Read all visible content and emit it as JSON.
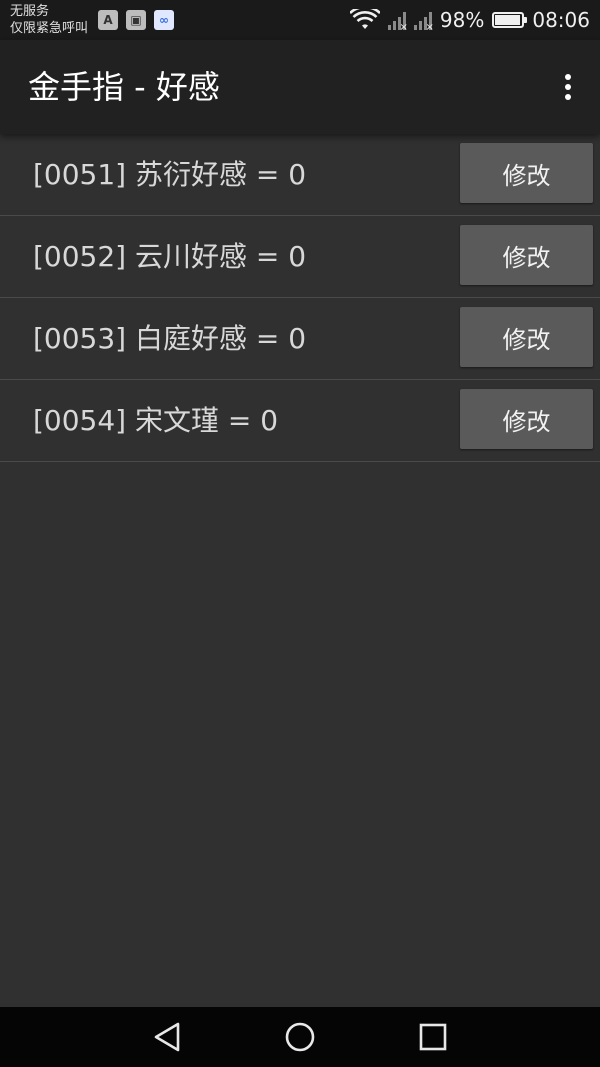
{
  "status_bar": {
    "carrier_line1": "无服务",
    "carrier_line2": "仅限紧急呼叫",
    "notif_icons": [
      "A",
      "▣",
      "∞"
    ],
    "battery_percent": "98%",
    "battery_level": 0.98,
    "time": "08:06"
  },
  "app_bar": {
    "title": "金手指 - 好感"
  },
  "items": [
    {
      "label": "[0051] 苏衍好感 = 0",
      "button": "修改"
    },
    {
      "label": "[0052] 云川好感 = 0",
      "button": "修改"
    },
    {
      "label": "[0053] 白庭好感 = 0",
      "button": "修改"
    },
    {
      "label": "[0054] 宋文瑾 = 0",
      "button": "修改"
    }
  ],
  "colors": {
    "background": "#303030",
    "app_bar": "#212121",
    "button": "#5a5a5a",
    "nav_bar": "#050505"
  }
}
